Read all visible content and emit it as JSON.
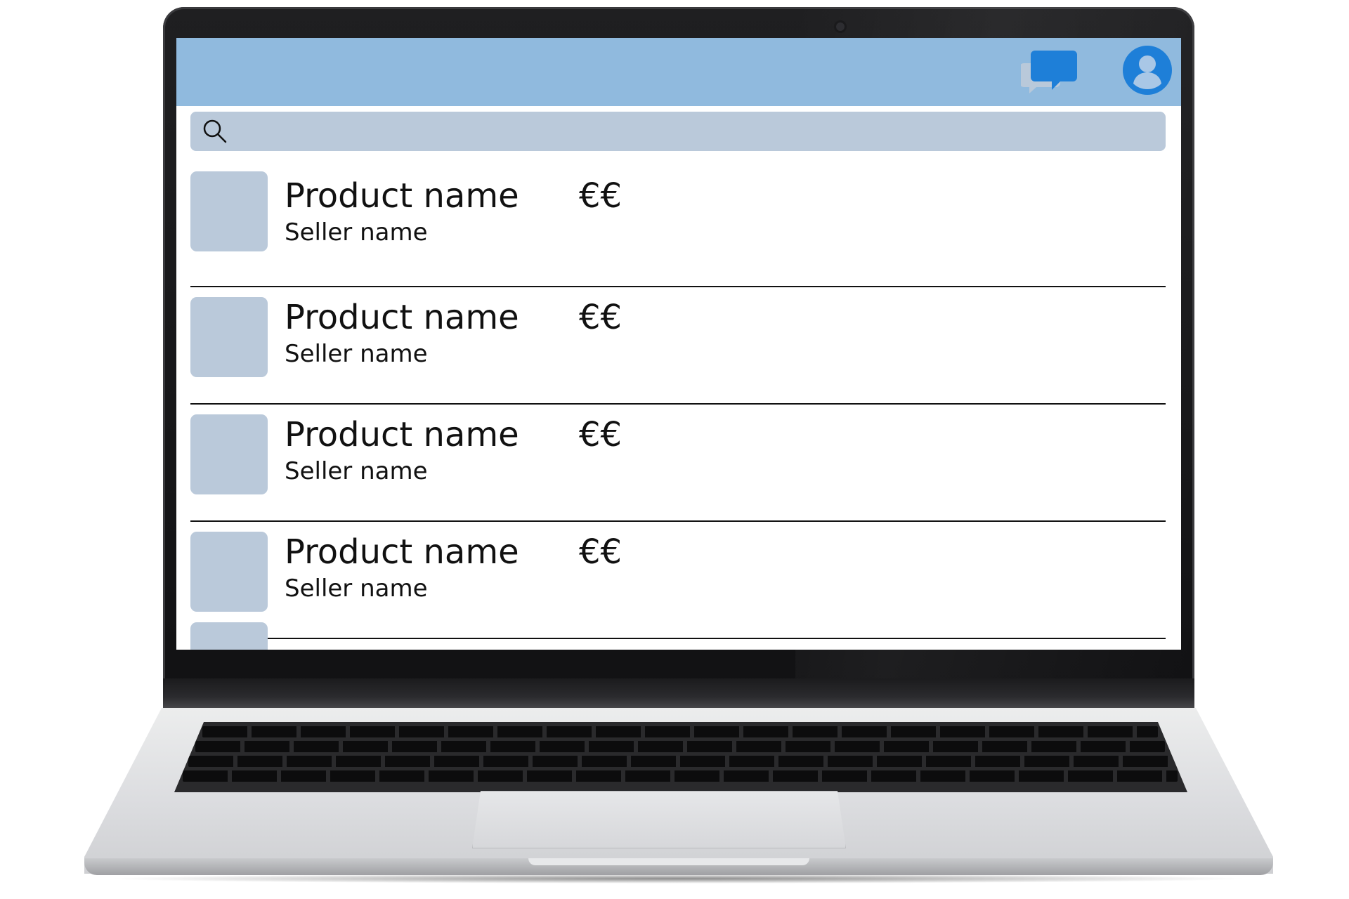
{
  "header": {
    "chat_icon": "chat-bubbles-icon",
    "account_icon": "user-account-icon",
    "accent_color": "#1e7fd8",
    "background_color": "#90bade"
  },
  "search": {
    "icon": "search-icon",
    "placeholder": "",
    "value": ""
  },
  "products": [
    {
      "name": "Product name",
      "seller": "Seller name",
      "price": "€€"
    },
    {
      "name": "Product name",
      "seller": "Seller name",
      "price": "€€"
    },
    {
      "name": "Product name",
      "seller": "Seller name",
      "price": "€€"
    },
    {
      "name": "Product name",
      "seller": "Seller name",
      "price": "€€"
    }
  ]
}
